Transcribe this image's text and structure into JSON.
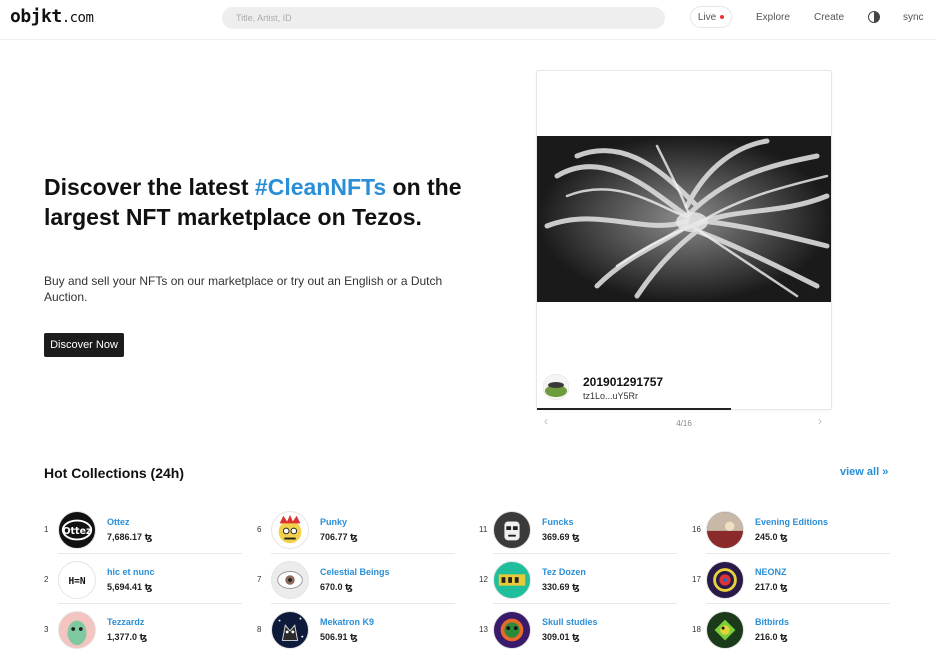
{
  "header": {
    "logo_main": "objkt",
    "logo_suffix": ".com",
    "search_placeholder": "Title, Artist, ID",
    "live_label": "Live",
    "nav": [
      "Explore",
      "Create"
    ],
    "sync_label": "sync",
    "theme_icon": "half-circle-icon"
  },
  "hero": {
    "title_pre": "Discover the latest ",
    "title_accent": "#CleanNFTs",
    "title_post": " on the largest NFT marketplace on Tezos.",
    "subtitle": "Buy and sell your NFTs on our marketplace or try out an English or a Dutch Auction.",
    "cta_label": "Discover Now"
  },
  "featured": {
    "title": "201901291757",
    "address": "tz1Lo...uY5Rr",
    "pager": "4/16",
    "progress": 0.66
  },
  "collections_section": {
    "title": "Hot Collections (24h)",
    "view_all": "view all »"
  },
  "collections": [
    {
      "rank": "1",
      "name": "Ottez",
      "volume": "7,686.17"
    },
    {
      "rank": "2",
      "name": "hic et nunc",
      "volume": "5,694.41"
    },
    {
      "rank": "3",
      "name": "Tezzardz",
      "volume": "1,377.0"
    },
    {
      "rank": "6",
      "name": "Punky",
      "volume": "706.77"
    },
    {
      "rank": "7",
      "name": "Celestial Beings",
      "volume": "670.0"
    },
    {
      "rank": "8",
      "name": "Mekatron K9",
      "volume": "506.91"
    },
    {
      "rank": "11",
      "name": "Funcks",
      "volume": "369.69"
    },
    {
      "rank": "12",
      "name": "Tez Dozen",
      "volume": "330.69"
    },
    {
      "rank": "13",
      "name": "Skull studies",
      "volume": "309.01"
    },
    {
      "rank": "16",
      "name": "Evening Editions",
      "volume": "245.0"
    },
    {
      "rank": "17",
      "name": "NEONZ",
      "volume": "217.0"
    },
    {
      "rank": "18",
      "name": "Bitbirds",
      "volume": "216.0"
    }
  ],
  "colors": {
    "accent": "#2a8fd6",
    "live_dot": "#e33333",
    "button_bg": "#1c1c1c"
  }
}
